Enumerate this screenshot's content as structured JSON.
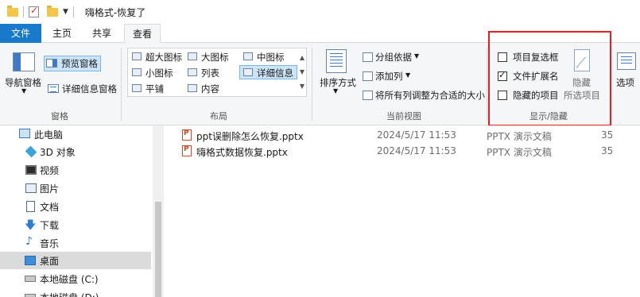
{
  "title_bar": {
    "title": "嗨格式-恢复了"
  },
  "tabs": [
    {
      "label": "文件"
    },
    {
      "label": "主页"
    },
    {
      "label": "共享"
    },
    {
      "label": "查看"
    }
  ],
  "ribbon": {
    "panes": {
      "nav_pane": "导航窗格",
      "preview": "预览窗格",
      "details": "详细信息窗格",
      "group": "窗格"
    },
    "layout": {
      "items": [
        "超大图标",
        "大图标",
        "中图标",
        "小图标",
        "列表",
        "详细信息",
        "平铺",
        "内容"
      ],
      "selected": "详细信息",
      "group": "布局"
    },
    "current_view": {
      "sort_by": "排序方式",
      "group_by": "分组依据",
      "add_column": "添加列",
      "fit_columns": "将所有列调整为合适的大小",
      "group": "当前视图"
    },
    "show_hide": {
      "item_checkboxes": {
        "label": "项目复选框",
        "checked": false
      },
      "file_extensions": {
        "label": "文件扩展名",
        "checked": true
      },
      "hidden_items": {
        "label": "隐藏的项目",
        "checked": false
      },
      "hide_selected_line1": "隐藏",
      "hide_selected_line2": "所选项目",
      "group": "显示/隐藏"
    },
    "options": "选项"
  },
  "nav": {
    "items": [
      {
        "label": "此电脑",
        "icon": "computer-icon"
      },
      {
        "label": "3D 对象",
        "icon": "cube-3d-icon"
      },
      {
        "label": "视频",
        "icon": "video-icon"
      },
      {
        "label": "图片",
        "icon": "picture-icon"
      },
      {
        "label": "文档",
        "icon": "document-icon"
      },
      {
        "label": "下载",
        "icon": "download-arrow-icon"
      },
      {
        "label": "音乐",
        "icon": "music-note-icon"
      },
      {
        "label": "桌面",
        "icon": "desktop-icon"
      },
      {
        "label": "本地磁盘 (C:)",
        "icon": "drive-icon"
      },
      {
        "label": "本地磁盘 (D:)",
        "icon": "drive-icon"
      }
    ],
    "selected": "桌面"
  },
  "files": [
    {
      "name": "ppt误删除怎么恢复.pptx",
      "date": "2024/5/17 11:53",
      "type": "PPTX 演示文稿",
      "size": "35"
    },
    {
      "name": "嗨格式数据恢复.pptx",
      "date": "2024/5/17 11:53",
      "type": "PPTX 演示文稿",
      "size": "35"
    }
  ],
  "colors": {
    "accent": "#1979ca",
    "selection": "#cce4f7",
    "highlight_frame": "#e3201f"
  }
}
